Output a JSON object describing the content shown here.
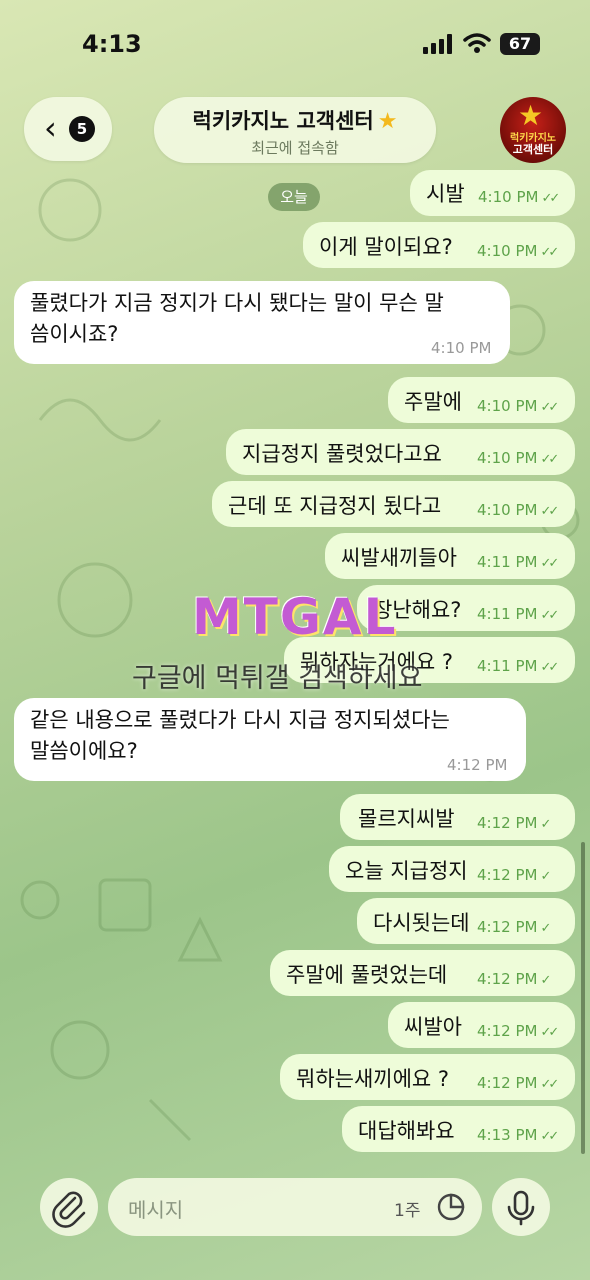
{
  "status_bar": {
    "time": "4:13",
    "battery": "67"
  },
  "header": {
    "back_badge": "5",
    "title": "럭키카지노 고객센터",
    "subtitle": "최근에 접속함",
    "avatar_line1": "럭키카지노",
    "avatar_line2": "고객센터"
  },
  "date_chip": "오늘",
  "messages": [
    {
      "text": "시발",
      "time": "4:10 PM"
    },
    {
      "text": "이게 말이되요?",
      "time": "4:10 PM"
    },
    {
      "line1": "풀렸다가 지금 정지가 다시 됐다는 말이 무슨 말",
      "line2": "씀이시죠?",
      "time": "4:10 PM"
    },
    {
      "text": "주말에",
      "time": "4:10 PM"
    },
    {
      "text": "지급정지 풀렷었다고요",
      "time": "4:10 PM"
    },
    {
      "text": "근데 또 지급정지 됬다고",
      "time": "4:10 PM"
    },
    {
      "text": "씨발새끼들아",
      "time": "4:11 PM"
    },
    {
      "text": "장난해요?",
      "time": "4:11 PM"
    },
    {
      "text": "뭐하자는거에요 ?",
      "time": "4:11 PM"
    },
    {
      "line1": "같은 내용으로 풀렸다가 다시 지급 정지되셨다는",
      "line2": "말씀이에요?",
      "time": "4:12 PM"
    },
    {
      "text": "몰르지씨발",
      "time": "4:12 PM"
    },
    {
      "text": "오늘 지급정지",
      "time": "4:12 PM"
    },
    {
      "text": "다시됫는데",
      "time": "4:12 PM"
    },
    {
      "text": "주말에 풀렷었는데",
      "time": "4:12 PM"
    },
    {
      "text": "씨발아",
      "time": "4:12 PM"
    },
    {
      "text": "뭐하는새끼에요 ?",
      "time": "4:12 PM"
    },
    {
      "text": "대답해봐요",
      "time": "4:13 PM"
    }
  ],
  "watermark": {
    "logo": "MTGAL",
    "caption": "구글에 먹튀갤 검색하세요"
  },
  "input": {
    "placeholder": "메시지",
    "timer_label": "1주"
  },
  "colors": {
    "outgoing_bubble": "#eefcd9",
    "incoming_bubble": "#ffffff",
    "accent": "#5ea34a"
  }
}
